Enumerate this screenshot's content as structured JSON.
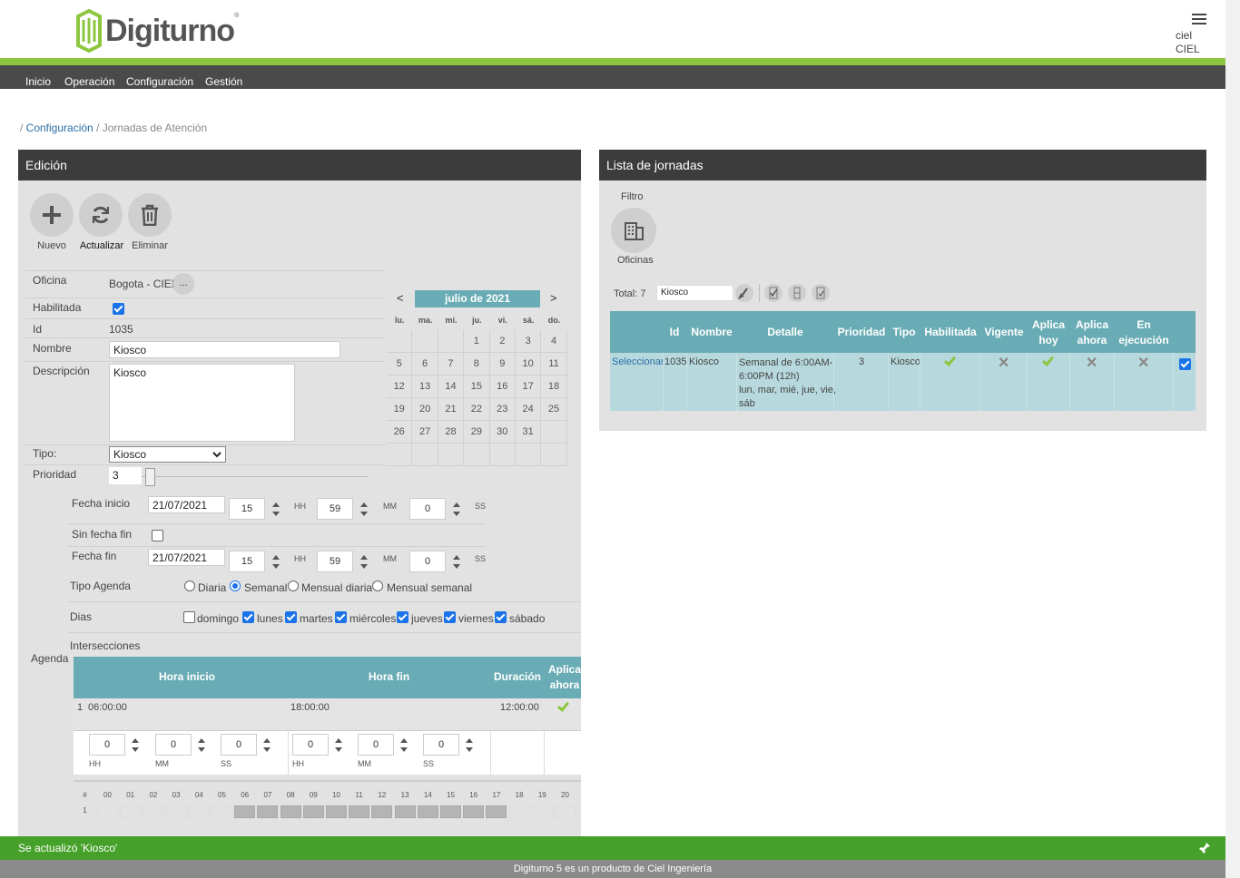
{
  "header": {
    "logo_text": "Digiturno",
    "logo_reg": "®",
    "user_line1": "ciel",
    "user_line2": "CIEL"
  },
  "nav": [
    "Inicio",
    "Operación",
    "Configuración",
    "Gestión"
  ],
  "breadcrumb": {
    "sep1": "/ ",
    "link": "Configuración",
    "sep2": " / ",
    "current": "Jornadas de Atención"
  },
  "edit": {
    "title": "Edición",
    "buttons": [
      "Nuevo",
      "Actualizar",
      "Eliminar"
    ],
    "oficina_label": "Oficina",
    "oficina_value": "Bogota - CIEL",
    "oficina_btn": "...",
    "habilitada_label": "Habilitada",
    "id_label": "Id",
    "id_value": "1035",
    "nombre_label": "Nombre",
    "nombre_value": "Kiosco",
    "descripcion_label": "Descripción",
    "descripcion_value": "Kiosco",
    "tipo_label": "Tipo:",
    "tipo_value": "Kiosco",
    "prioridad_label": "Prioridad",
    "prioridad_value": "3",
    "fecha_inicio_label": "Fecha inicio",
    "fecha_inicio": "21/07/2021",
    "fi_hh": "15",
    "fi_mm": "59",
    "fi_ss": "0",
    "sin_fecha_fin_label": "Sin fecha fin",
    "fecha_fin_label": "Fecha fin",
    "fecha_fin": "21/07/2021",
    "ff_hh": "15",
    "ff_mm": "59",
    "ff_ss": "0",
    "hh": "HH",
    "mm": "MM",
    "ss": "SS",
    "tipo_agenda_label": "Tipo Agenda",
    "tipo_agenda_options": [
      "Diaria",
      "Semanal",
      "Mensual diaria",
      "Mensual semanal"
    ],
    "tipo_agenda_selected": "Semanal",
    "dias_label": "Dias",
    "dias": [
      {
        "label": "domingo",
        "checked": false
      },
      {
        "label": "lunes",
        "checked": true
      },
      {
        "label": "martes",
        "checked": true
      },
      {
        "label": "miércoles",
        "checked": true
      },
      {
        "label": "jueves",
        "checked": true
      },
      {
        "label": "viernes",
        "checked": true
      },
      {
        "label": "sábado",
        "checked": true
      }
    ],
    "intersecciones_label": "Intersecciones",
    "agenda_label": "Agenda",
    "agenda_headers": [
      "Hora inicio",
      "Hora fin",
      "Duración",
      "Aplica ahora"
    ],
    "agenda_row": {
      "num": "1",
      "inicio": "06:00:00",
      "fin": "18:00:00",
      "duracion": "12:00:00"
    },
    "spin_values": [
      "0",
      "0",
      "0",
      "0",
      "0",
      "0"
    ],
    "timeline_hash": "#",
    "timeline_hours": [
      "00",
      "01",
      "02",
      "03",
      "04",
      "05",
      "06",
      "07",
      "08",
      "09",
      "10",
      "11",
      "12",
      "13",
      "14",
      "15",
      "16",
      "17",
      "18",
      "19",
      "20"
    ],
    "timeline_row": "1",
    "timeline_active_from": 6,
    "timeline_active_to": 17
  },
  "calendar": {
    "prev": "<",
    "next": ">",
    "month": "julio de 2021",
    "dow": [
      "lu.",
      "ma.",
      "mi.",
      "ju.",
      "vi.",
      "sá.",
      "do."
    ],
    "weeks": [
      [
        "",
        "",
        "",
        "1",
        "2",
        "3",
        "4"
      ],
      [
        "5",
        "6",
        "7",
        "8",
        "9",
        "10",
        "11"
      ],
      [
        "12",
        "13",
        "14",
        "15",
        "16",
        "17",
        "18"
      ],
      [
        "19",
        "20",
        "21",
        "22",
        "23",
        "24",
        "25"
      ],
      [
        "26",
        "27",
        "28",
        "29",
        "30",
        "31",
        ""
      ],
      [
        "",
        "",
        "",
        "",
        "",
        "",
        ""
      ]
    ]
  },
  "list": {
    "title": "Lista de jornadas",
    "filtro_label": "Filtro",
    "oficinas_label": "Oficinas",
    "total": "Total: 7",
    "search_value": "Kiosco",
    "headers": [
      "Id",
      "Nombre",
      "Detalle",
      "Prioridad",
      "Tipo",
      "Habilitada",
      "Vigente",
      "Aplica hoy",
      "Aplica ahora",
      "En ejecución"
    ],
    "row": {
      "action": "Seleccionar",
      "id": "1035",
      "nombre": "Kiosco",
      "detalle_1": "Semanal de 6:00AM-",
      "detalle_2": "6:00PM (12h)",
      "detalle_3": "lun, mar, mié, jue, vie,",
      "detalle_4": "sáb",
      "prioridad": "3",
      "tipo": "Kiosco"
    }
  },
  "notification": "Se actualizó 'Kiosco'",
  "footer": "Digiturno 5 es un producto de Ciel Ingeniería",
  "colors": {
    "green": "#8dc63f",
    "teal": "#6aacb5",
    "dark": "#3c3c3c",
    "notif": "#46a12a"
  }
}
